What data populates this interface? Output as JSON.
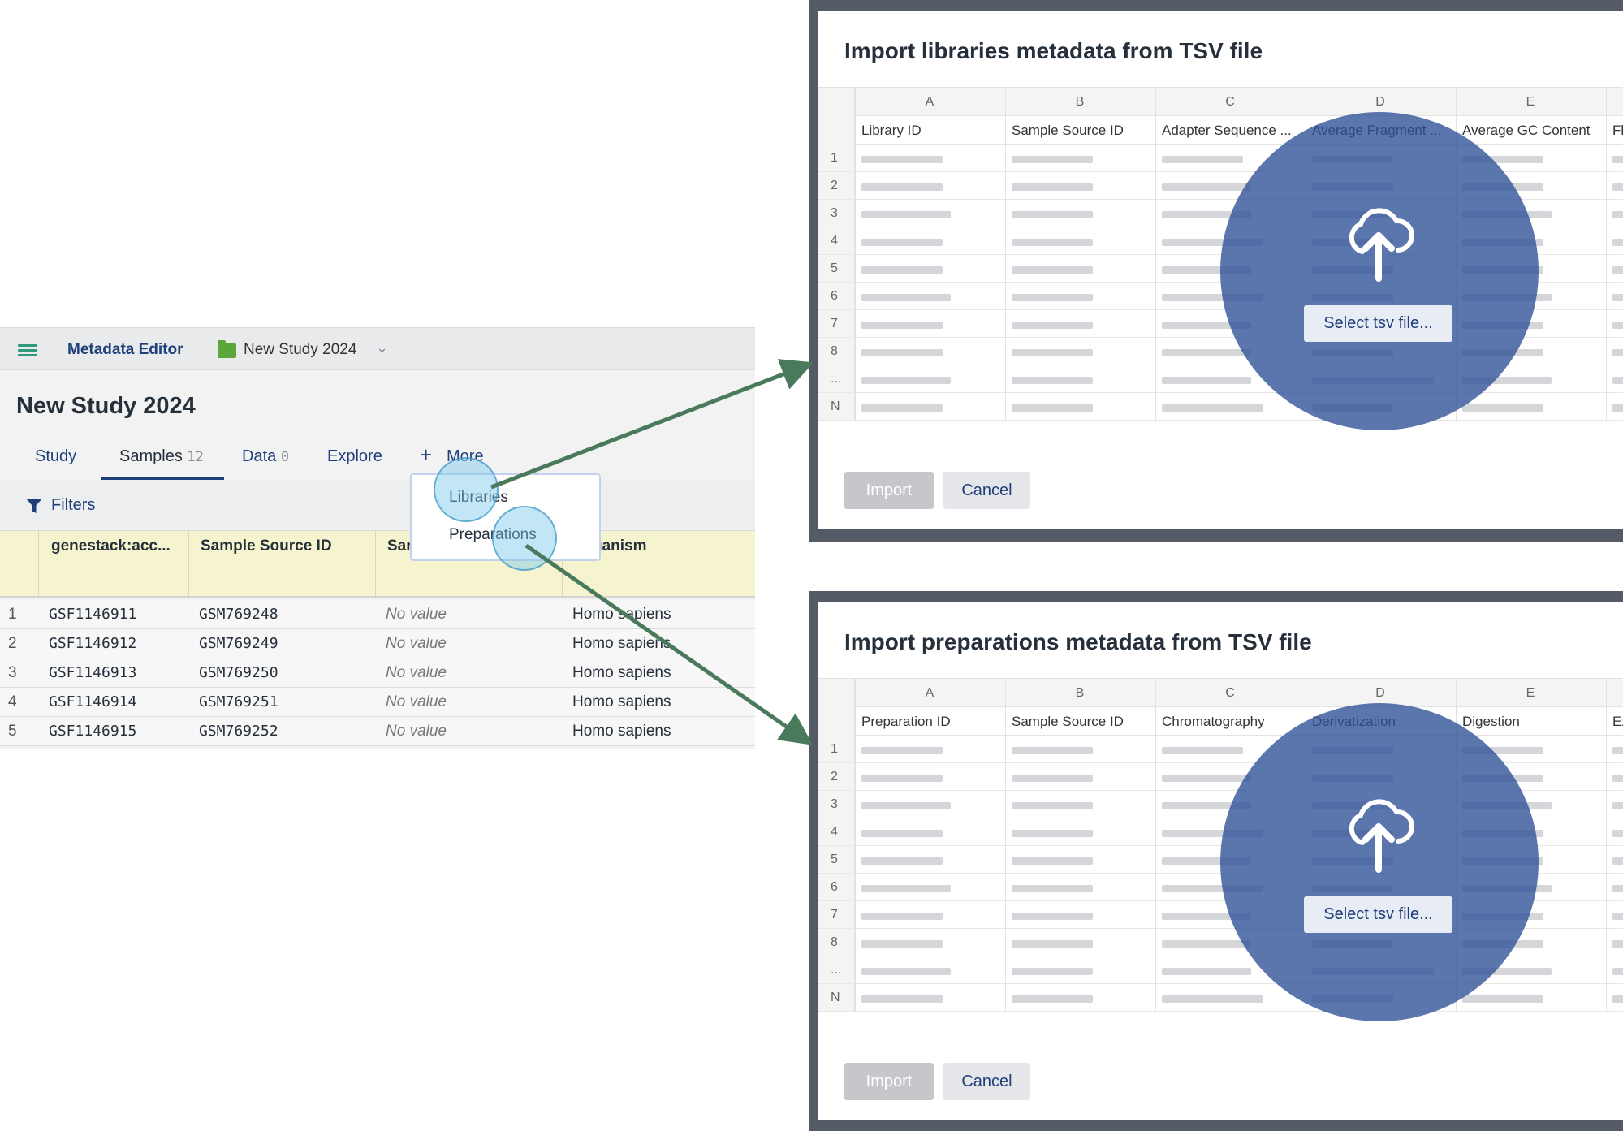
{
  "app": {
    "name": "Metadata Editor",
    "study": "New Study 2024",
    "page_title": "New Study 2024",
    "tabs": [
      {
        "label": "Study"
      },
      {
        "label": "Samples",
        "count": "12"
      },
      {
        "label": "Data",
        "count": "0"
      },
      {
        "label": "Explore"
      },
      {
        "label": "More"
      }
    ],
    "filters_label": "Filters",
    "table": {
      "headers": [
        "genestack:acc...",
        "Sample Source ID",
        "Sar",
        "ganism"
      ],
      "rows": [
        {
          "n": "1",
          "acc": "GSF1146911",
          "src": "GSM769248",
          "val": "No value",
          "org": "Homo sapiens"
        },
        {
          "n": "2",
          "acc": "GSF1146912",
          "src": "GSM769249",
          "val": "No value",
          "org": "Homo sapiens"
        },
        {
          "n": "3",
          "acc": "GSF1146913",
          "src": "GSM769250",
          "val": "No value",
          "org": "Homo sapiens"
        },
        {
          "n": "4",
          "acc": "GSF1146914",
          "src": "GSM769251",
          "val": "No value",
          "org": "Homo sapiens"
        },
        {
          "n": "5",
          "acc": "GSF1146915",
          "src": "GSM769252",
          "val": "No value",
          "org": "Homo sapiens"
        }
      ]
    },
    "menu": [
      "Libraries",
      "Preparations"
    ]
  },
  "dialogs": {
    "libraries": {
      "title": "Import libraries metadata from TSV file",
      "col_letters": [
        "A",
        "B",
        "C",
        "D",
        "E"
      ],
      "col_headers": [
        "Library ID",
        "Sample Source ID",
        "Adapter Sequence ...",
        "Average Fragment ...",
        "Average GC Content",
        "Fl"
      ],
      "row_labels": [
        "1",
        "2",
        "3",
        "4",
        "5",
        "6",
        "7",
        "8",
        "...",
        "N"
      ],
      "select_label": "Select tsv file...",
      "import_label": "Import",
      "cancel_label": "Cancel"
    },
    "preparations": {
      "title": "Import preparations metadata from TSV file",
      "col_letters": [
        "A",
        "B",
        "C",
        "D",
        "E"
      ],
      "col_headers": [
        "Preparation ID",
        "Sample Source ID",
        "Chromatography",
        "Derivatization",
        "Digestion",
        "Ex"
      ],
      "row_labels": [
        "1",
        "2",
        "3",
        "4",
        "5",
        "6",
        "7",
        "8",
        "...",
        "N"
      ],
      "select_label": "Select tsv file...",
      "import_label": "Import",
      "cancel_label": "Cancel"
    }
  },
  "colors": {
    "accent": "#1f3f7a",
    "arrow": "#4a7a5c",
    "overlay": "#2d5096",
    "header_bg": "#f5f4cf"
  },
  "icons": {
    "menu": "hamburger-icon",
    "folder": "folder-icon",
    "filter": "filter-icon",
    "upload": "cloud-upload-icon"
  }
}
